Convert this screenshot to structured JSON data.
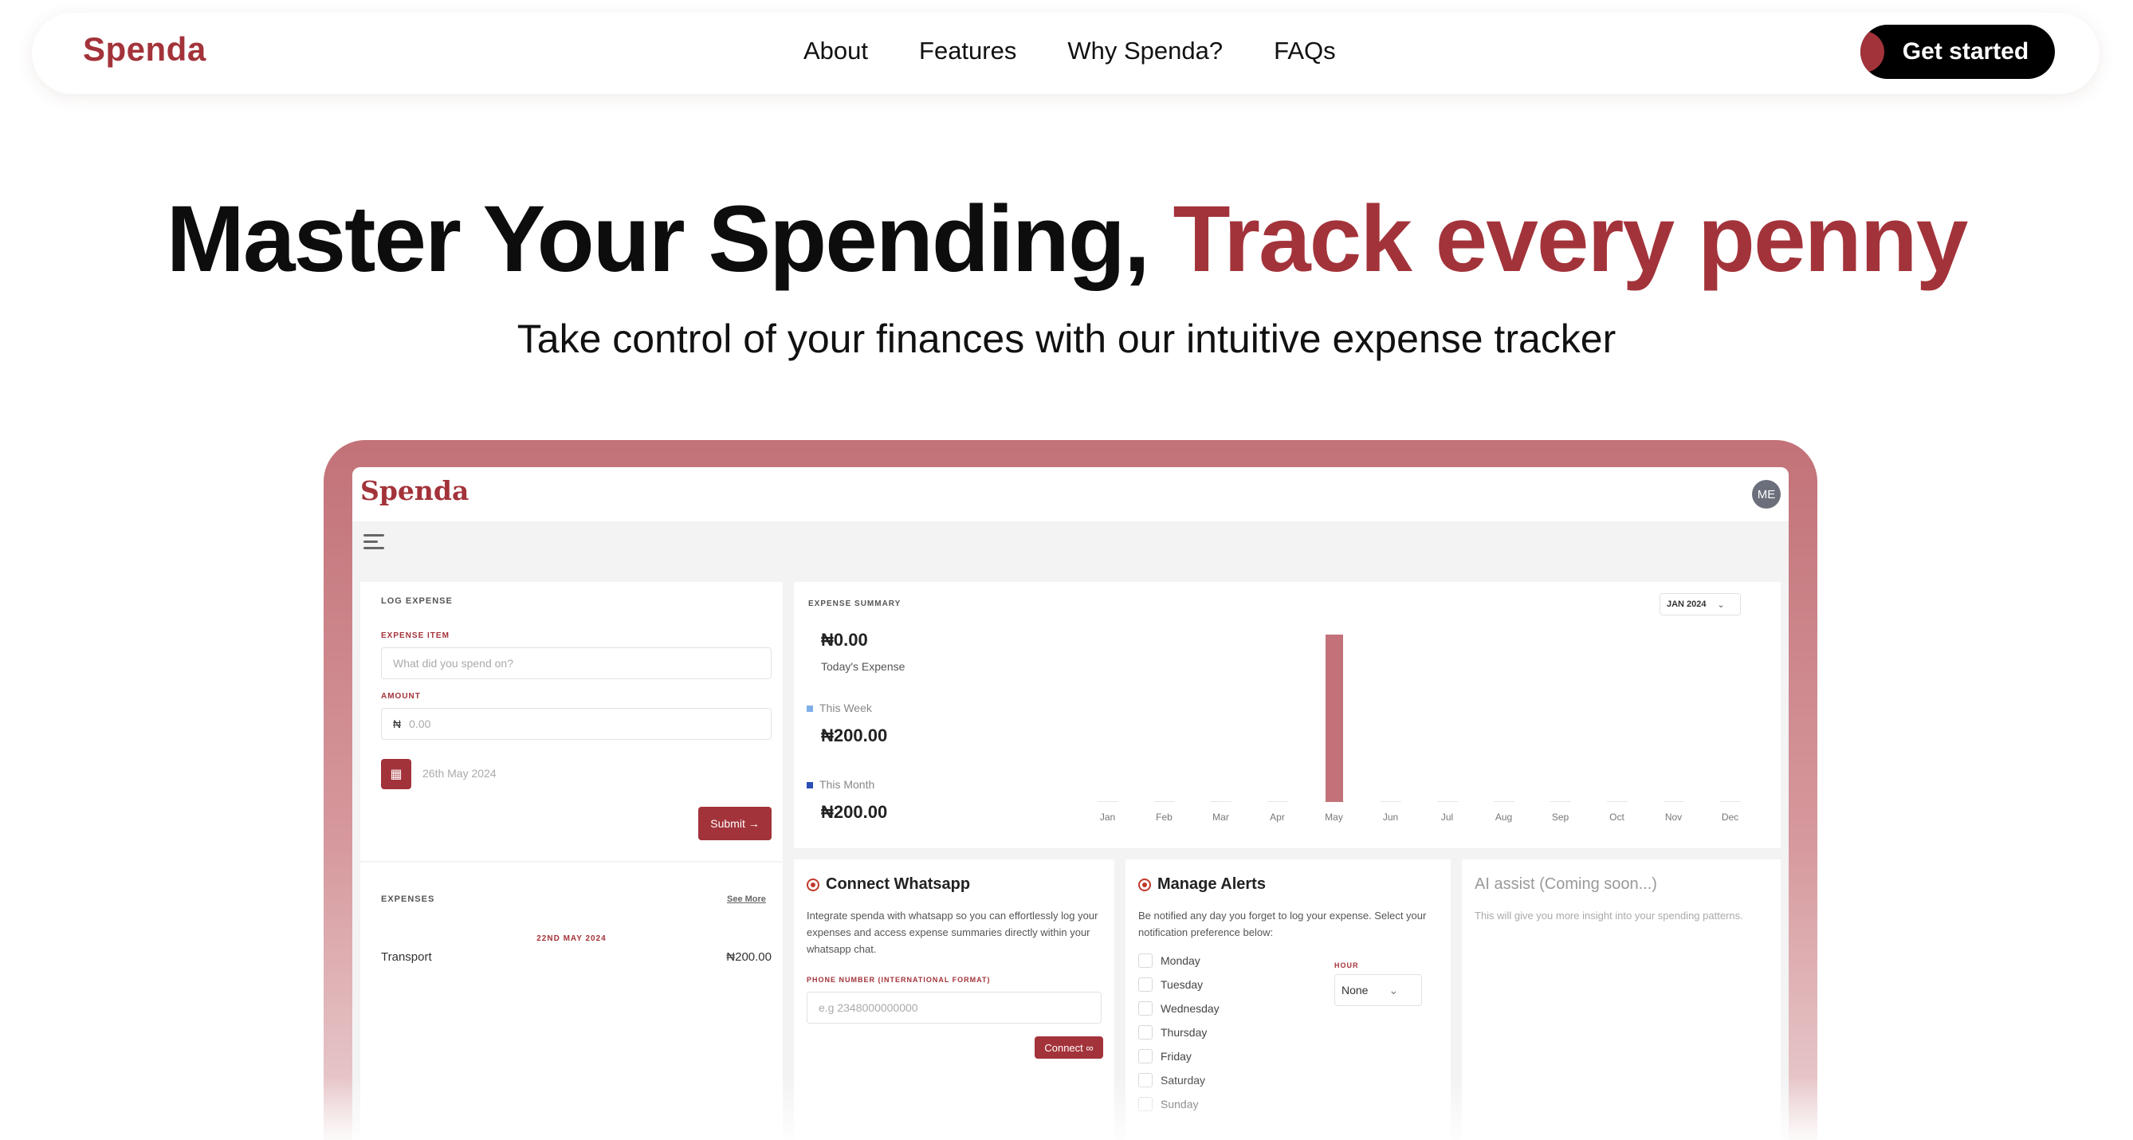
{
  "nav": {
    "brand": "Spenda",
    "links": [
      "About",
      "Features",
      "Why Spenda?",
      "FAQs"
    ],
    "cta": "Get started"
  },
  "hero": {
    "title_main": "Master Your Spending, ",
    "title_accent": "Track every penny",
    "subtitle": "Take control of your finances with our intuitive expense tracker"
  },
  "colors": {
    "brand": "#a3333a",
    "frame": "#c27278",
    "cta_bg": "#000000"
  },
  "app": {
    "brand": "Spenda",
    "avatar": "ME",
    "log": {
      "heading": "LOG EXPENSE",
      "item_label": "EXPENSE ITEM",
      "item_placeholder": "What did you spend on?",
      "amount_label": "AMOUNT",
      "currency": "₦",
      "amount_placeholder": "0.00",
      "date": "26th May 2024",
      "submit": "Submit →"
    },
    "expenses": {
      "heading": "EXPENSES",
      "see_more": "See More",
      "date": "22ND MAY 2024",
      "item": "Transport",
      "amount": "₦200.00"
    },
    "summary": {
      "heading": "EXPENSE SUMMARY",
      "month_select": "JAN 2024",
      "today_amount": "₦0.00",
      "today_label": "Today's Expense",
      "week_label": "This Week",
      "week_amount": "₦200.00",
      "month_label": "This Month",
      "month_amount": "₦200.00"
    },
    "whatsapp": {
      "title": "Connect Whatsapp",
      "text": "Integrate spenda with whatsapp so you can effortlessly log your expenses and access expense summaries directly within your whatsapp chat.",
      "phone_label": "PHONE NUMBER (INTERNATIONAL FORMAT)",
      "phone_placeholder": "e.g 2348000000000",
      "connect": "Connect ∞"
    },
    "alerts": {
      "title": "Manage Alerts",
      "text": "Be notified any day you forget to log your expense. Select your notification preference below:",
      "hour_label": "HOUR",
      "hour_value": "None",
      "days": [
        "Monday",
        "Tuesday",
        "Wednesday",
        "Thursday",
        "Friday",
        "Saturday",
        "Sunday"
      ]
    },
    "ai": {
      "title": "AI assist (Coming soon...)",
      "text": "This will give you more insight into your spending patterns."
    }
  },
  "chart_data": {
    "type": "bar",
    "categories": [
      "Jan",
      "Feb",
      "Mar",
      "Apr",
      "May",
      "Jun",
      "Jul",
      "Aug",
      "Sep",
      "Oct",
      "Nov",
      "Dec"
    ],
    "values": [
      0,
      0,
      0,
      0,
      200,
      0,
      0,
      0,
      0,
      0,
      0,
      0
    ],
    "ylim": [
      0,
      200
    ],
    "title": "",
    "xlabel": "",
    "ylabel": ""
  }
}
